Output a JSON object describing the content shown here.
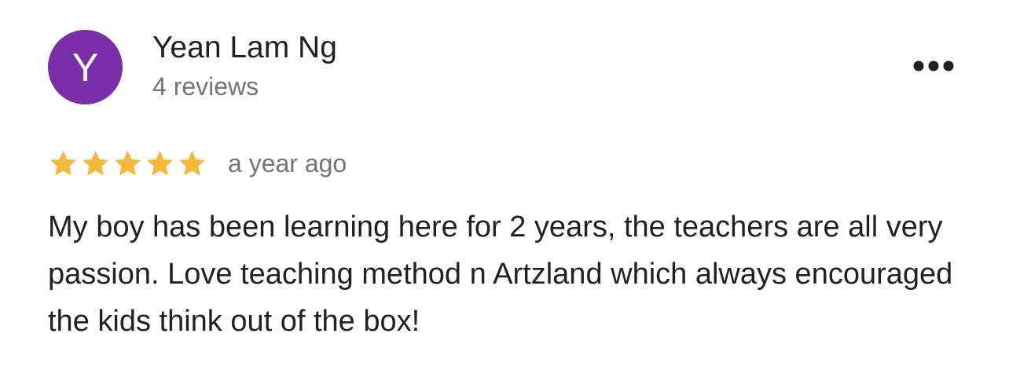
{
  "review": {
    "avatar_initial": "Y",
    "author_name": "Yean Lam Ng",
    "review_count": "4 reviews",
    "rating": 5,
    "rating_max": 5,
    "time_ago": "a year ago",
    "text": "My boy has been learning here for 2 years, the teachers are all very passion. Love teaching method n Artzland which always encouraged the kids think out of the box!"
  },
  "icons": {
    "more": "more-horizontal-icon",
    "star": "star-icon"
  },
  "colors": {
    "avatar_bg": "#7a2fa8",
    "star": "#f4b93c",
    "primary_text": "#202124",
    "secondary_text": "#70757a"
  }
}
